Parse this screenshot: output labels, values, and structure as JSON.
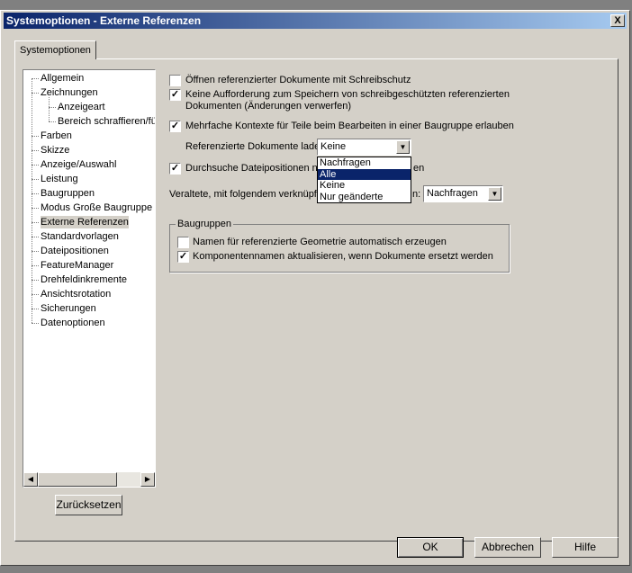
{
  "window": {
    "title": "Systemoptionen - Externe Referenzen",
    "close": "X"
  },
  "tab": "Systemoptionen",
  "tree": {
    "items": [
      {
        "label": "Allgemein",
        "level": 0
      },
      {
        "label": "Zeichnungen",
        "level": 0
      },
      {
        "label": "Anzeigeart",
        "level": 1
      },
      {
        "label": "Bereich schraffieren/füllen",
        "level": 1
      },
      {
        "label": "Farben",
        "level": 0
      },
      {
        "label": "Skizze",
        "level": 0
      },
      {
        "label": "Anzeige/Auswahl",
        "level": 0
      },
      {
        "label": "Leistung",
        "level": 0
      },
      {
        "label": "Baugruppen",
        "level": 0
      },
      {
        "label": "Modus Große Baugruppe",
        "level": 0
      },
      {
        "label": "Externe Referenzen",
        "level": 0,
        "selected": true
      },
      {
        "label": "Standardvorlagen",
        "level": 0
      },
      {
        "label": "Dateipositionen",
        "level": 0
      },
      {
        "label": "FeatureManager",
        "level": 0
      },
      {
        "label": "Drehfeldinkremente",
        "level": 0
      },
      {
        "label": "Ansichtsrotation",
        "level": 0
      },
      {
        "label": "Sicherungen",
        "level": 0
      },
      {
        "label": "Datenoptionen",
        "level": 0
      }
    ],
    "reset": "Zurücksetzen"
  },
  "options": {
    "readonly": {
      "label": "Öffnen referenzierter Dokumente mit Schreibschutz",
      "checked": false
    },
    "nosave": {
      "label1": "Keine Aufforderung zum Speichern von schreibgeschützten referenzierten",
      "label2": "Dokumenten (Änderungen verwerfen)",
      "checked": true
    },
    "multicontext": {
      "label": "Mehrfache Kontexte für Teile beim Bearbeiten in einer Baugruppe erlauben",
      "checked": true
    },
    "load": {
      "label": "Referenzierte Dokumente laden:",
      "value": "Keine",
      "options": [
        "Nachfragen",
        "Alle",
        "Keine",
        "Nur geänderte"
      ],
      "highlighted": "Alle"
    },
    "search": {
      "label": "Durchsuche Dateipositionen na",
      "label_tail": "en",
      "checked": true
    },
    "outdated": {
      "label": "Veraltete, mit folgendem verknüpfte",
      "label_tail": "n:",
      "value": "Nachfragen"
    }
  },
  "group": {
    "title": "Baugruppen",
    "names": {
      "label": "Namen für referenzierte Geometrie automatisch erzeugen",
      "checked": false
    },
    "update": {
      "label": "Komponentennamen aktualisieren, wenn Dokumente ersetzt werden",
      "checked": true
    }
  },
  "buttons": {
    "ok": "OK",
    "cancel": "Abbrechen",
    "help": "Hilfe"
  }
}
